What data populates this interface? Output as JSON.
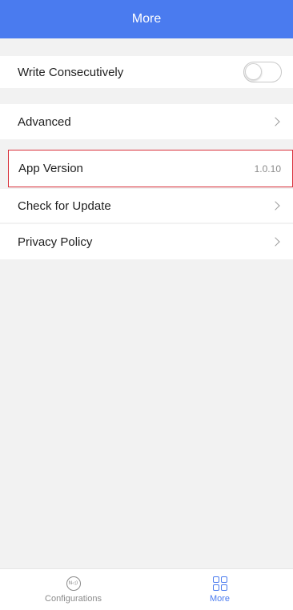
{
  "header": {
    "title": "More"
  },
  "settings": {
    "write_consecutively": {
      "label": "Write Consecutively",
      "enabled": false
    },
    "advanced": {
      "label": "Advanced"
    },
    "app_version": {
      "label": "App Version",
      "value": "1.0.10"
    },
    "check_update": {
      "label": "Check for Update"
    },
    "privacy_policy": {
      "label": "Privacy Policy"
    }
  },
  "tabbar": {
    "tabs": [
      {
        "label": "Configurations",
        "icon": "nfc-icon",
        "active": false
      },
      {
        "label": "More",
        "icon": "grid-icon",
        "active": true
      }
    ]
  },
  "colors": {
    "accent": "#4a7bef",
    "highlight_border": "#d9303a",
    "background": "#f2f2f2"
  }
}
